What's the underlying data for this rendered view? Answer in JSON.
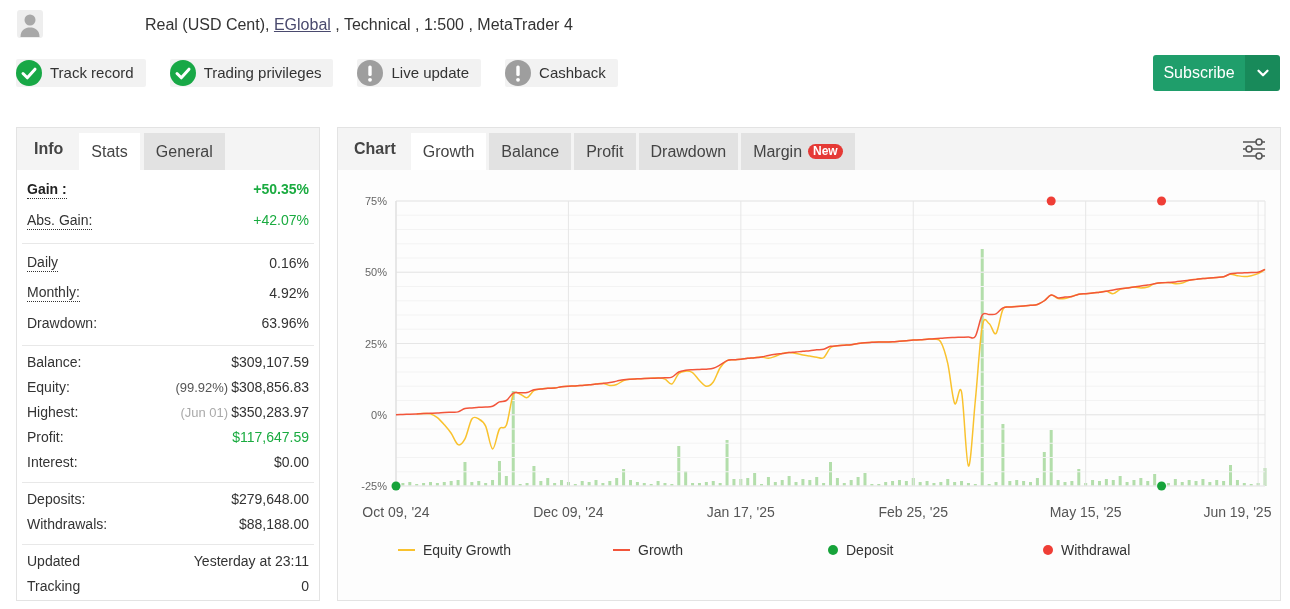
{
  "header": {
    "account": "Real (USD Cent),",
    "broker": "EGlobal",
    "details": ", Technical , 1:500 , MetaTrader 4"
  },
  "badges": [
    {
      "label": "Track record",
      "verified": true
    },
    {
      "label": "Trading privileges",
      "verified": true
    },
    {
      "label": "Live update",
      "verified": false
    },
    {
      "label": "Cashback",
      "verified": false
    }
  ],
  "subscribe_button": {
    "label": "Subscribe"
  },
  "info_panel": {
    "title": "Info",
    "tabs": [
      {
        "label": "Stats",
        "selected": true
      },
      {
        "label": "General",
        "selected": false
      }
    ],
    "sections": [
      {
        "rows": [
          {
            "label": "Gain :",
            "value": "+50.35%",
            "hint": true,
            "strong": true,
            "positive": true
          },
          {
            "label": "Abs. Gain:",
            "value": "+42.07%",
            "hint": true,
            "strong": false,
            "positive": true
          }
        ]
      },
      {
        "rows": [
          {
            "label": "Daily",
            "value": "0.16%",
            "hint": true,
            "strong": false,
            "positive": false
          },
          {
            "label": "Monthly:",
            "value": "4.92%",
            "hint": true,
            "strong": false,
            "positive": false
          },
          {
            "label": "Drawdown:",
            "value": "63.96%",
            "hint": false,
            "strong": false,
            "positive": false
          }
        ]
      },
      {
        "rows": [
          {
            "label": "Balance:",
            "value": "$309,107.59",
            "hint": false,
            "strong": false,
            "positive": false
          },
          {
            "label": "Equity:",
            "note": {
              "text": "(99.92%)",
              "muted": false
            },
            "value": "$308,856.83",
            "hint": false,
            "strong": false,
            "positive": false
          },
          {
            "label": "Highest:",
            "note": {
              "text": "(Jun 01)",
              "muted": true
            },
            "value": "$350,283.97",
            "hint": false,
            "strong": false,
            "positive": false
          },
          {
            "label": "Profit:",
            "value": "$117,647.59",
            "hint": false,
            "strong": false,
            "positive": true
          },
          {
            "label": "Interest:",
            "value": "$0.00",
            "hint": false,
            "strong": false,
            "positive": false
          }
        ]
      },
      {
        "rows": [
          {
            "label": "Deposits:",
            "value": "$279,648.00",
            "hint": false,
            "strong": false,
            "positive": false
          },
          {
            "label": "Withdrawals:",
            "value": "$88,188.00",
            "hint": false,
            "strong": false,
            "positive": false
          }
        ]
      },
      {
        "rows": [
          {
            "label": "Updated",
            "value": "Yesterday at 23:11",
            "hint": false,
            "strong": false,
            "positive": false
          },
          {
            "label": "Tracking",
            "value": "0",
            "hint": false,
            "strong": false,
            "positive": false
          }
        ]
      }
    ]
  },
  "chart_panel": {
    "title": "Chart",
    "tabs": [
      {
        "label": "Growth",
        "selected": true
      },
      {
        "label": "Balance",
        "selected": false
      },
      {
        "label": "Profit",
        "selected": false
      },
      {
        "label": "Drawdown",
        "selected": false
      },
      {
        "label": "Margin",
        "selected": false,
        "badge": "New"
      }
    ],
    "chart_data": {
      "type": "line",
      "grid": true,
      "legend": true,
      "categories": [
        "Oct 09, '24",
        null,
        null,
        null,
        null,
        null,
        null,
        null,
        null,
        null,
        null,
        null,
        null,
        null,
        null,
        null,
        null,
        null,
        null,
        null,
        null,
        null,
        null,
        null,
        null,
        "Dec 09, '24",
        null,
        null,
        null,
        null,
        null,
        null,
        null,
        null,
        null,
        null,
        null,
        null,
        null,
        null,
        null,
        null,
        null,
        null,
        null,
        null,
        null,
        null,
        null,
        null,
        "Jan 17, '25",
        null,
        null,
        null,
        null,
        null,
        null,
        null,
        null,
        null,
        null,
        null,
        null,
        null,
        null,
        null,
        null,
        null,
        null,
        null,
        null,
        null,
        null,
        null,
        null,
        "Feb 25, '25",
        null,
        null,
        null,
        null,
        null,
        null,
        null,
        null,
        null,
        null,
        null,
        null,
        null,
        null,
        null,
        null,
        null,
        null,
        null,
        null,
        null,
        null,
        null,
        null,
        "May 15, '25",
        null,
        null,
        null,
        null,
        null,
        null,
        null,
        null,
        null,
        null,
        null,
        null,
        null,
        null,
        null,
        null,
        null,
        null,
        null,
        null,
        null,
        "Jun 19, '25",
        null,
        null,
        null,
        null
      ],
      "ylim": [
        -25,
        75
      ],
      "yticks": [
        {
          "value": 75,
          "label": "75%"
        },
        {
          "value": 50,
          "label": "50%"
        },
        {
          "value": 25,
          "label": "25%"
        },
        {
          "value": 0,
          "label": "0%"
        },
        {
          "value": -25,
          "label": "-25%"
        }
      ],
      "series": [
        {
          "name": "Equity Growth",
          "type": "line",
          "color": "#f9c22e",
          "values": [
            null,
            null,
            null,
            0.3,
            0.4,
            0.3,
            -1,
            -3.5,
            -6.5,
            -10.5,
            -8.5,
            -1.5,
            -1.5,
            -4,
            -12,
            -5,
            -3.7,
            7,
            7.2,
            6,
            8.5,
            9,
            9.3,
            9.4,
            9.8,
            10,
            10.1,
            10.3,
            10.5,
            10.8,
            11,
            10.3,
            10.6,
            12,
            12.5,
            12.6,
            12.7,
            12.8,
            12.9,
            12.5,
            10.8,
            14.5,
            15.3,
            14.8,
            12,
            10,
            11.5,
            16.5,
            19,
            19.3,
            19.5,
            19.8,
            20,
            20.3,
            19.8,
            20.5,
            21.5,
            21.8,
            21.5,
            21,
            20.6,
            20.2,
            20,
            23.5,
            24.2,
            24.4,
            24.6,
            25,
            25.3,
            25.4,
            25.5,
            25.5,
            25.6,
            25.8,
            26,
            26.2,
            26.3,
            26.5,
            26.5,
            25.5,
            18,
            4,
            8,
            -18,
            5,
            31,
            32,
            28.5,
            37,
            37.8,
            38,
            38.2,
            38.4,
            38.7,
            40,
            42,
            40.8,
            40.8,
            41.5,
            42.3,
            42.5,
            42.7,
            43,
            43.3,
            42.5,
            44,
            44.5,
            44.8,
            44.5,
            44.8,
            46,
            46.3,
            46.4,
            46,
            46.2,
            47.2,
            47.5,
            47.8,
            48,
            48.2,
            48.4,
            49.3,
            48.8,
            48.5,
            48.8,
            49.5,
            51
          ]
        },
        {
          "name": "Growth",
          "type": "line",
          "color": "#f2553b",
          "values": [
            0,
            0.1,
            0.2,
            0.3,
            0.4,
            0.5,
            0.6,
            0.8,
            0.9,
            1,
            2.2,
            2.4,
            2.6,
            2.7,
            3,
            4.5,
            5,
            7.6,
            7.7,
            7.8,
            8.8,
            9,
            9.3,
            9.4,
            9.8,
            10,
            10.1,
            10.3,
            10.5,
            10.8,
            11,
            11.3,
            11.8,
            12.3,
            12.5,
            12.6,
            12.7,
            12.8,
            12.9,
            13,
            13.2,
            15,
            15.6,
            15.8,
            15.9,
            16,
            16.3,
            17.5,
            19,
            19.3,
            19.5,
            19.8,
            20,
            20.3,
            20.8,
            21.2,
            21.5,
            21.8,
            22,
            22.3,
            22.5,
            22.8,
            23,
            24,
            24.2,
            24.4,
            24.6,
            25,
            25.3,
            25.4,
            25.5,
            25.5,
            25.6,
            25.8,
            26,
            26.2,
            26.3,
            26.5,
            26.7,
            26.8,
            27,
            27.1,
            27.2,
            27.3,
            27.5,
            35,
            35.2,
            35.4,
            37.5,
            37.8,
            38,
            38.2,
            38.4,
            38.7,
            40,
            42,
            41,
            41.3,
            41.5,
            42.3,
            42.5,
            42.7,
            43,
            43.3,
            43.8,
            44.2,
            44.5,
            44.8,
            45.2,
            45.5,
            46,
            46.3,
            46.4,
            46.6,
            46.9,
            47.2,
            47.5,
            47.8,
            48,
            48.2,
            48.4,
            49.5,
            49.7,
            49.8,
            49.9,
            50,
            51
          ]
        },
        {
          "name": "Deposit",
          "type": "scatter",
          "color": "#16a33a",
          "values": [
            -25,
            null,
            null,
            null,
            null,
            null,
            null,
            null,
            null,
            null,
            null,
            null,
            null,
            null,
            null,
            null,
            null,
            null,
            null,
            null,
            null,
            null,
            null,
            null,
            null,
            null,
            null,
            null,
            null,
            null,
            null,
            null,
            null,
            null,
            null,
            null,
            null,
            null,
            null,
            null,
            null,
            null,
            null,
            null,
            null,
            null,
            null,
            null,
            null,
            null,
            null,
            null,
            null,
            null,
            null,
            null,
            null,
            null,
            null,
            null,
            null,
            null,
            null,
            null,
            null,
            null,
            null,
            null,
            null,
            null,
            null,
            null,
            null,
            null,
            null,
            null,
            null,
            null,
            null,
            null,
            null,
            null,
            null,
            null,
            null,
            null,
            null,
            null,
            null,
            null,
            null,
            null,
            null,
            null,
            null,
            null,
            null,
            null,
            null,
            null,
            null,
            null,
            null,
            null,
            null,
            null,
            null,
            null,
            null,
            null,
            null,
            -25,
            null,
            null,
            null,
            null,
            null,
            null,
            null,
            null,
            null,
            null,
            null,
            null,
            null,
            null,
            null
          ]
        },
        {
          "name": "Withdrawal",
          "type": "scatter",
          "color": "#ef3e36",
          "values": [
            null,
            null,
            null,
            null,
            null,
            null,
            null,
            null,
            null,
            null,
            null,
            null,
            null,
            null,
            null,
            null,
            null,
            null,
            null,
            null,
            null,
            null,
            null,
            null,
            null,
            null,
            null,
            null,
            null,
            null,
            null,
            null,
            null,
            null,
            null,
            null,
            null,
            null,
            null,
            null,
            null,
            null,
            null,
            null,
            null,
            null,
            null,
            null,
            null,
            null,
            null,
            null,
            null,
            null,
            null,
            null,
            null,
            null,
            null,
            null,
            null,
            null,
            null,
            null,
            null,
            null,
            null,
            null,
            null,
            null,
            null,
            null,
            null,
            null,
            null,
            null,
            null,
            null,
            null,
            null,
            null,
            null,
            null,
            null,
            null,
            null,
            null,
            null,
            null,
            null,
            null,
            null,
            null,
            null,
            null,
            75,
            null,
            null,
            null,
            null,
            null,
            null,
            null,
            null,
            null,
            null,
            null,
            null,
            null,
            null,
            null,
            75,
            null,
            null,
            null,
            null,
            null,
            null,
            null,
            null,
            null,
            null,
            null,
            null,
            null,
            null,
            null
          ]
        }
      ]
    }
  }
}
